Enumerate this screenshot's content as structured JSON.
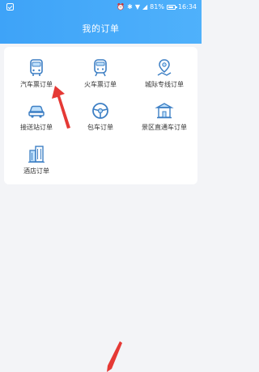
{
  "status_bar": {
    "time": "16:34",
    "battery": "81%",
    "icons": [
      "alarm-icon",
      "bluetooth-icon",
      "wifi-icon",
      "signal-icon",
      "battery-icon"
    ]
  },
  "header": {
    "title": "我的订单",
    "color": "#4aaaf9"
  },
  "orders": [
    {
      "label": "汽车票订单",
      "icon": "bus-icon"
    },
    {
      "label": "火车票订单",
      "icon": "train-icon"
    },
    {
      "label": "城际专线订单",
      "icon": "route-pin-icon"
    },
    {
      "label": "接送站订单",
      "icon": "car-icon"
    },
    {
      "label": "包车订单",
      "icon": "steering-wheel-icon"
    },
    {
      "label": "景区直通车订单",
      "icon": "scenic-gate-icon"
    },
    {
      "label": "酒店订单",
      "icon": "hotel-building-icon"
    }
  ],
  "colors": {
    "accent": "#3b9ef5",
    "icon_stroke": "#3d7fc4",
    "annotation_arrow": "#e53935",
    "page_background": "#f3f4f7"
  }
}
